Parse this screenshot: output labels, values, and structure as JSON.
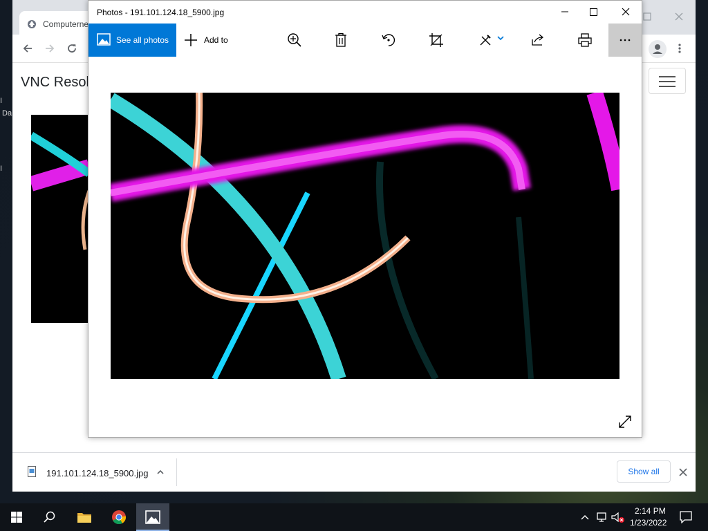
{
  "photos_window": {
    "title": "Photos - 191.101.124.18_5900.jpg",
    "toolbar": {
      "see_all_label": "See all photos",
      "add_to_label": "Add to",
      "more_label": "..."
    }
  },
  "chrome": {
    "tab_title": "Computerne",
    "page_heading": "VNC Resolv",
    "side_fragments": [
      "I",
      "Da",
      "I"
    ]
  },
  "download_bar": {
    "file_name": "191.101.124.18_5900.jpg",
    "show_all_label": "Show all"
  },
  "taskbar": {
    "time": "2:14 PM",
    "date": "1/23/2022"
  },
  "colors": {
    "accent": "#0078d7",
    "link": "#1a73e8",
    "taskbar": "#0f1318"
  }
}
